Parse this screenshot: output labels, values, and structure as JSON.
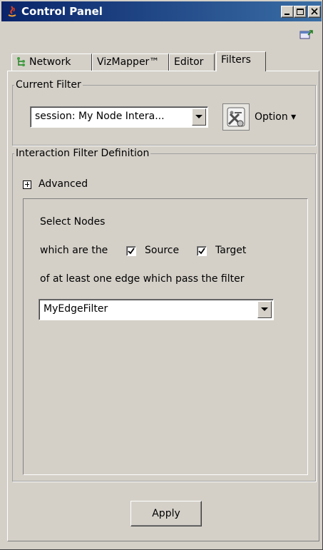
{
  "window": {
    "title": "Control Panel"
  },
  "tabs": [
    {
      "label": "Network",
      "icon": "network-tree-icon"
    },
    {
      "label": "VizMapper™"
    },
    {
      "label": "Editor"
    },
    {
      "label": "Filters",
      "active": true
    }
  ],
  "current_filter": {
    "group_title": "Current Filter",
    "selected": "session: My Node Intera...",
    "option_label": "Option ▾"
  },
  "interaction": {
    "group_title": "Interaction Filter Definition",
    "advanced_label": "Advanced",
    "select_nodes": "Select Nodes",
    "which_are_the": "which are the",
    "source_label": "Source",
    "source_checked": true,
    "target_label": "Target",
    "target_checked": true,
    "edge_text": "of at least one edge which pass the filter",
    "edge_filter_selected": "MyEdgeFilter"
  },
  "footer": {
    "apply_label": "Apply"
  },
  "colors": {
    "titlebar_start": "#0a246a",
    "titlebar_end": "#3a6ea5",
    "face": "#d4d0c8"
  }
}
